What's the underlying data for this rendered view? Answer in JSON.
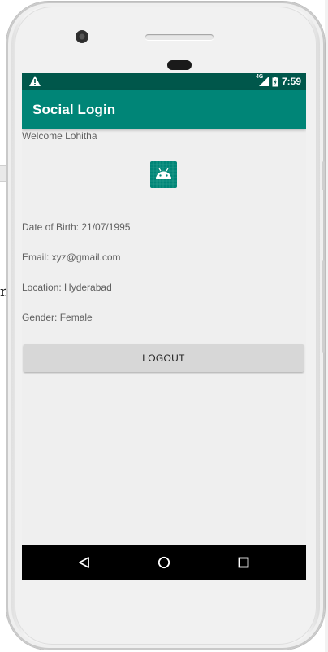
{
  "status_bar": {
    "time": "7:59",
    "network": "4G",
    "icons": [
      "warning-icon",
      "signal-icon",
      "battery-icon"
    ]
  },
  "app_bar": {
    "title": "Social Login"
  },
  "profile": {
    "welcome": "Welcome Lohitha",
    "avatar_icon": "android-icon",
    "dob": "Date of Birth: 21/07/1995",
    "email": "Email: xyz@gmail.com",
    "location": "Location: Hyderabad",
    "gender": "Gender: Female"
  },
  "actions": {
    "logout_label": "LOGOUT"
  },
  "nav_bar": {
    "icons": [
      "back-icon",
      "home-icon",
      "recents-icon"
    ]
  },
  "background": {
    "fragment_letter": "n"
  },
  "colors": {
    "primary": "#008577",
    "primary_dark": "#00574b",
    "screen_bg": "#efefef",
    "button_bg": "#d7d7d7"
  }
}
